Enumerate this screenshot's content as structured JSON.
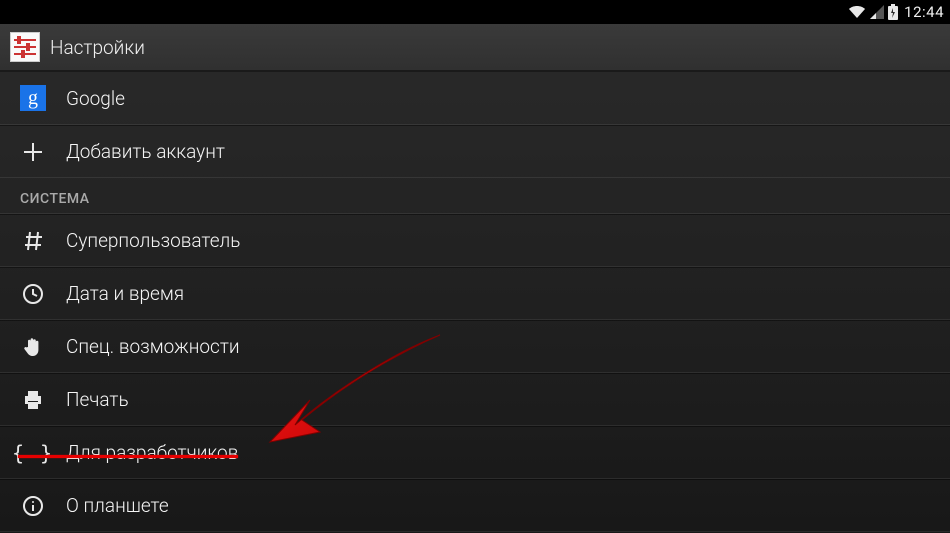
{
  "status": {
    "time": "12:44"
  },
  "title_bar": {
    "app_title": "Настройки"
  },
  "rows": {
    "google": "Google",
    "add_account": "Добавить аккаунт",
    "superuser": "Суперпользователь",
    "datetime": "Дата и время",
    "accessibility": "Спец. возможности",
    "print": "Печать",
    "developer": "Для разработчиков",
    "about": "О планшете"
  },
  "sections": {
    "system": "СИСТЕМА"
  }
}
